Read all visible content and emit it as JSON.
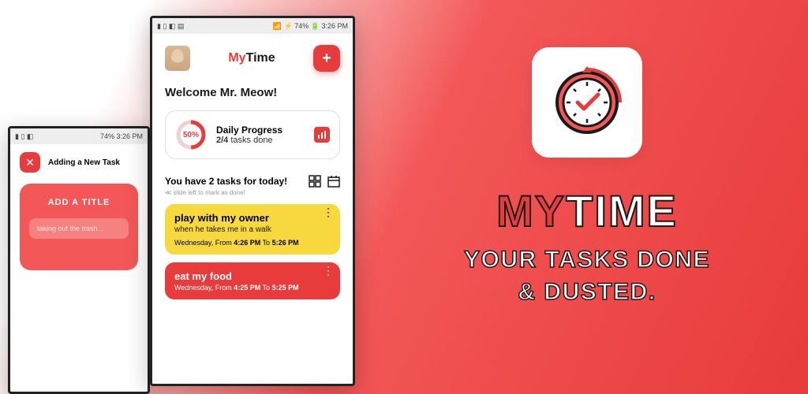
{
  "brand": {
    "my": "MY",
    "time": "TIME",
    "tagline1": "YOUR TASKS DONE",
    "tagline2": "& DUSTED."
  },
  "statusbar": {
    "battery": "74%",
    "time": "3:26 PM"
  },
  "header": {
    "title_my": "My",
    "title_time": "Time"
  },
  "welcome": "Welcome Mr. Meow!",
  "progress": {
    "pct": "50%",
    "label": "Daily Progress",
    "done": "2/4",
    "suffix": " tasks done"
  },
  "tasks_header": "You have 2 tasks for today!",
  "hint": "≪ slide left to mark as done!",
  "tasks": [
    {
      "title": "play with my owner",
      "desc": "when he takes me in a walk",
      "day": "Wednesday, From ",
      "from": "4:26 PM",
      "mid": " To ",
      "to": "5:26 PM"
    },
    {
      "title": "eat my food",
      "desc": "",
      "day": "Wednesday, From ",
      "from": "4:25 PM",
      "mid": " To ",
      "to": "5:25 PM"
    }
  ],
  "back": {
    "title": "Adding a New Task",
    "heading": "ADD A TITLE",
    "placeholder": "taking out the trash..."
  }
}
